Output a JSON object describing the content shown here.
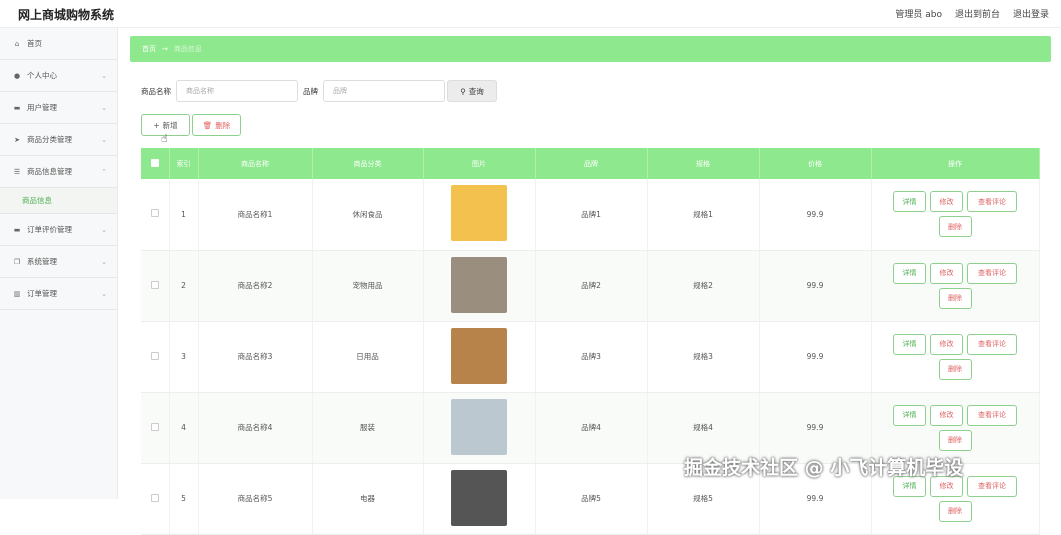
{
  "header": {
    "title": "网上商城购物系统",
    "user_label": "管理员 abo",
    "frontend_link": "退出到前台",
    "logout_link": "退出登录"
  },
  "sidebar": {
    "items": [
      {
        "label": "首页",
        "icon": "home-icon"
      },
      {
        "label": "个人中心",
        "icon": "user-icon"
      },
      {
        "label": "用户管理",
        "icon": "monitor-icon"
      },
      {
        "label": "商品分类管理",
        "icon": "send-icon"
      },
      {
        "label": "商品信息管理",
        "icon": "list-icon"
      },
      {
        "label": "商品信息",
        "icon": ""
      },
      {
        "label": "订单评价管理",
        "icon": "monitor-icon"
      },
      {
        "label": "系统管理",
        "icon": "copy-icon"
      },
      {
        "label": "订单管理",
        "icon": "chart-icon"
      }
    ]
  },
  "breadcrumb": {
    "root": "首页",
    "sep": "→",
    "current": "商品信息"
  },
  "search": {
    "name_label": "商品名称",
    "name_placeholder": "商品名称",
    "brand_label": "品牌",
    "brand_placeholder": "品牌",
    "button": "查询"
  },
  "actions": {
    "add": "新增",
    "delete": "删除"
  },
  "table": {
    "headers": [
      "索引",
      "商品名称",
      "商品分类",
      "图片",
      "品牌",
      "规格",
      "价格",
      "操作"
    ],
    "rows": [
      {
        "index": "1",
        "name": "商品名称1",
        "category": "休闲食品",
        "brand": "品牌1",
        "spec": "规格1",
        "price": "99.9",
        "image_color": "#f2c14e"
      },
      {
        "index": "2",
        "name": "商品名称2",
        "category": "宠物用品",
        "brand": "品牌2",
        "spec": "规格2",
        "price": "99.9",
        "image_color": "#9a8f7e"
      },
      {
        "index": "3",
        "name": "商品名称3",
        "category": "日用品",
        "brand": "品牌3",
        "spec": "规格3",
        "price": "99.9",
        "image_color": "#b8834a"
      },
      {
        "index": "4",
        "name": "商品名称4",
        "category": "服装",
        "brand": "品牌4",
        "spec": "规格4",
        "price": "99.9",
        "image_color": "#bcc8d0"
      },
      {
        "index": "5",
        "name": "商品名称5",
        "category": "电器",
        "brand": "品牌5",
        "spec": "规格5",
        "price": "99.9",
        "image_color": "#555555"
      }
    ],
    "ops": {
      "detail": "详情",
      "edit": "修改",
      "comments": "查看评论",
      "delete": "删除"
    }
  },
  "watermark": "掘金技术社区 @ 小飞计算机毕设"
}
